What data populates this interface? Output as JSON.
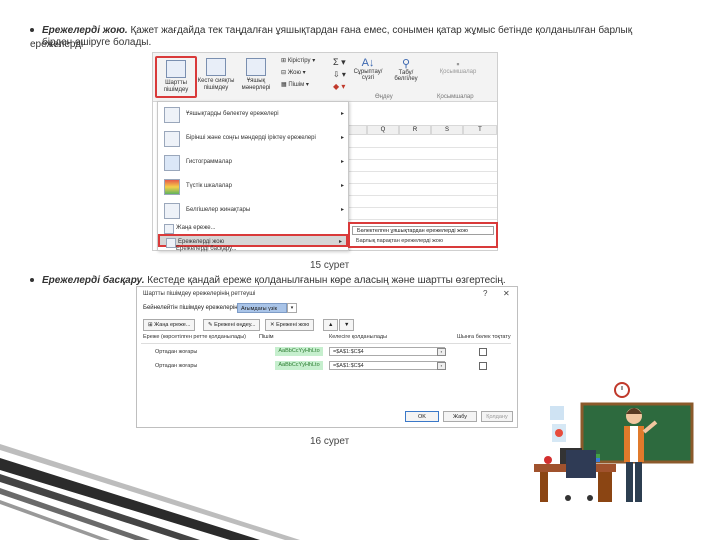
{
  "bullet1": {
    "bold": "Ережелерді жою.",
    "text": "Қажет жағдайда тек таңдалған ұяшықтардан ғана емес, сонымен қатар жұмыс бетінде қолданылған барлық ережелерді",
    "text2": "бірден өшіруге болады."
  },
  "ribbon": {
    "btn_conditional": "Шартты\nпішімдеу",
    "btn_table": "Кесте сияқты\nпішімдеу",
    "btn_cellstyles": "Ұяшық\nмәнерлері",
    "insert": "Кірістіру",
    "delete": "Жою",
    "format": "Пішім",
    "sort": "Сұрыптау/\nсүзгі",
    "find": "Табу/\nбелгілеу",
    "group_edit": "Өңдеу",
    "addins": "Қосымшалар",
    "group_addins": "Қосымшалар"
  },
  "menu": {
    "items": [
      "Ұяшықтарды бөлектеу ережелері",
      "Бірінші және соңғы мәндерді іріктеу ережелері",
      "Гистограммалар",
      "Түстік шкалалар",
      "Белгішелер жинақтары",
      "Жаңа ереже...",
      "Ережелерді жою",
      "Ережелерді басқару..."
    ]
  },
  "grid": {
    "columns": [
      "Q",
      "R",
      "S",
      "T"
    ]
  },
  "submenu": {
    "item1": "Бөлектелген ұяшықтардан ережелерді жою",
    "item2": "Барлық парақтан ережелерді жою"
  },
  "caption1": "15 сурет",
  "bullet2": {
    "bold": "Ережелерді басқару.",
    "text": "Кестеде қандай ереже қолданылғанын көре аласың және шартты өзгертесің."
  },
  "dialog": {
    "title": "Шартты пішімдеу ережелерінің реттеуші",
    "show_rules_label": "Бейнелейтін пішімдеу ережелерін ету:",
    "show_rules_value": "Ағымдағы үзік",
    "btn_new": "Жаңа ереже...",
    "btn_edit": "Ережені өңдеу...",
    "btn_delete": "Ережені жою",
    "col_rule": "Ереже (көрсетілген ретте қолданылады)",
    "col_format": "Пішім",
    "col_applies": "Келесіге қолданылады",
    "col_stop": "Шынға бөлек тоқтату",
    "rows": [
      {
        "rule": "Ортадан жоғары",
        "format": "AaBbCcYyHhLtо",
        "applies": "=$A$1:$C$4"
      },
      {
        "rule": "Ортадан жоғары",
        "format": "AaBbCcYyHhLtо",
        "applies": "=$A$1:$C$4"
      }
    ],
    "ok": "OK",
    "close": "Жабу",
    "apply": "Қолдану"
  },
  "caption2": "16 сурет",
  "colors": {
    "highlight": "#d93a3a",
    "board": "#2d6a3e",
    "teacher_vest": "#e07a2b"
  }
}
